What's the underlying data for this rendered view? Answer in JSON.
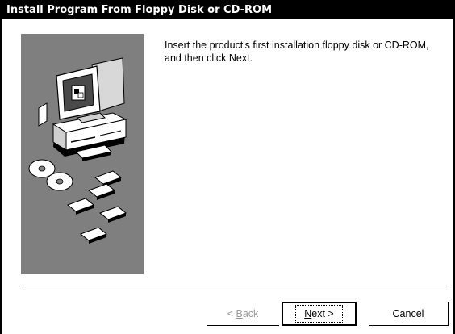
{
  "window": {
    "title": "Install Program From Floppy Disk or CD-ROM"
  },
  "main": {
    "message_line1": "Insert the product's first installation floppy disk or CD-ROM,",
    "message_line2": "and then click Next."
  },
  "buttons": {
    "back_prefix": "< ",
    "back_mnemonic": "B",
    "back_rest": "ack",
    "next_mnemonic": "N",
    "next_rest": "ext >",
    "cancel_label": "Cancel"
  },
  "colors": {
    "titlebar": "#000000",
    "panel": "#7f7f7f",
    "disabled_text": "#9a9a9a"
  },
  "icons": [
    "computer-icon",
    "cd-rom-icon",
    "floppy-disk-icon"
  ]
}
